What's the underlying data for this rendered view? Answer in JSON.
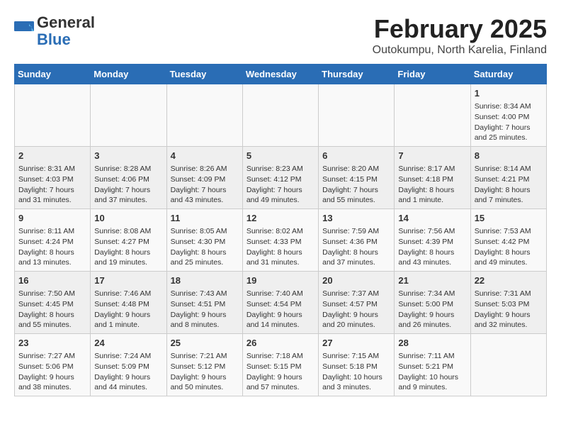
{
  "logo": {
    "general": "General",
    "blue": "Blue"
  },
  "title": "February 2025",
  "subtitle": "Outokumpu, North Karelia, Finland",
  "weekdays": [
    "Sunday",
    "Monday",
    "Tuesday",
    "Wednesday",
    "Thursday",
    "Friday",
    "Saturday"
  ],
  "weeks": [
    [
      {
        "day": "",
        "info": ""
      },
      {
        "day": "",
        "info": ""
      },
      {
        "day": "",
        "info": ""
      },
      {
        "day": "",
        "info": ""
      },
      {
        "day": "",
        "info": ""
      },
      {
        "day": "",
        "info": ""
      },
      {
        "day": "1",
        "info": "Sunrise: 8:34 AM\nSunset: 4:00 PM\nDaylight: 7 hours and 25 minutes."
      }
    ],
    [
      {
        "day": "2",
        "info": "Sunrise: 8:31 AM\nSunset: 4:03 PM\nDaylight: 7 hours and 31 minutes."
      },
      {
        "day": "3",
        "info": "Sunrise: 8:28 AM\nSunset: 4:06 PM\nDaylight: 7 hours and 37 minutes."
      },
      {
        "day": "4",
        "info": "Sunrise: 8:26 AM\nSunset: 4:09 PM\nDaylight: 7 hours and 43 minutes."
      },
      {
        "day": "5",
        "info": "Sunrise: 8:23 AM\nSunset: 4:12 PM\nDaylight: 7 hours and 49 minutes."
      },
      {
        "day": "6",
        "info": "Sunrise: 8:20 AM\nSunset: 4:15 PM\nDaylight: 7 hours and 55 minutes."
      },
      {
        "day": "7",
        "info": "Sunrise: 8:17 AM\nSunset: 4:18 PM\nDaylight: 8 hours and 1 minute."
      },
      {
        "day": "8",
        "info": "Sunrise: 8:14 AM\nSunset: 4:21 PM\nDaylight: 8 hours and 7 minutes."
      }
    ],
    [
      {
        "day": "9",
        "info": "Sunrise: 8:11 AM\nSunset: 4:24 PM\nDaylight: 8 hours and 13 minutes."
      },
      {
        "day": "10",
        "info": "Sunrise: 8:08 AM\nSunset: 4:27 PM\nDaylight: 8 hours and 19 minutes."
      },
      {
        "day": "11",
        "info": "Sunrise: 8:05 AM\nSunset: 4:30 PM\nDaylight: 8 hours and 25 minutes."
      },
      {
        "day": "12",
        "info": "Sunrise: 8:02 AM\nSunset: 4:33 PM\nDaylight: 8 hours and 31 minutes."
      },
      {
        "day": "13",
        "info": "Sunrise: 7:59 AM\nSunset: 4:36 PM\nDaylight: 8 hours and 37 minutes."
      },
      {
        "day": "14",
        "info": "Sunrise: 7:56 AM\nSunset: 4:39 PM\nDaylight: 8 hours and 43 minutes."
      },
      {
        "day": "15",
        "info": "Sunrise: 7:53 AM\nSunset: 4:42 PM\nDaylight: 8 hours and 49 minutes."
      }
    ],
    [
      {
        "day": "16",
        "info": "Sunrise: 7:50 AM\nSunset: 4:45 PM\nDaylight: 8 hours and 55 minutes."
      },
      {
        "day": "17",
        "info": "Sunrise: 7:46 AM\nSunset: 4:48 PM\nDaylight: 9 hours and 1 minute."
      },
      {
        "day": "18",
        "info": "Sunrise: 7:43 AM\nSunset: 4:51 PM\nDaylight: 9 hours and 8 minutes."
      },
      {
        "day": "19",
        "info": "Sunrise: 7:40 AM\nSunset: 4:54 PM\nDaylight: 9 hours and 14 minutes."
      },
      {
        "day": "20",
        "info": "Sunrise: 7:37 AM\nSunset: 4:57 PM\nDaylight: 9 hours and 20 minutes."
      },
      {
        "day": "21",
        "info": "Sunrise: 7:34 AM\nSunset: 5:00 PM\nDaylight: 9 hours and 26 minutes."
      },
      {
        "day": "22",
        "info": "Sunrise: 7:31 AM\nSunset: 5:03 PM\nDaylight: 9 hours and 32 minutes."
      }
    ],
    [
      {
        "day": "23",
        "info": "Sunrise: 7:27 AM\nSunset: 5:06 PM\nDaylight: 9 hours and 38 minutes."
      },
      {
        "day": "24",
        "info": "Sunrise: 7:24 AM\nSunset: 5:09 PM\nDaylight: 9 hours and 44 minutes."
      },
      {
        "day": "25",
        "info": "Sunrise: 7:21 AM\nSunset: 5:12 PM\nDaylight: 9 hours and 50 minutes."
      },
      {
        "day": "26",
        "info": "Sunrise: 7:18 AM\nSunset: 5:15 PM\nDaylight: 9 hours and 57 minutes."
      },
      {
        "day": "27",
        "info": "Sunrise: 7:15 AM\nSunset: 5:18 PM\nDaylight: 10 hours and 3 minutes."
      },
      {
        "day": "28",
        "info": "Sunrise: 7:11 AM\nSunset: 5:21 PM\nDaylight: 10 hours and 9 minutes."
      },
      {
        "day": "",
        "info": ""
      }
    ]
  ]
}
